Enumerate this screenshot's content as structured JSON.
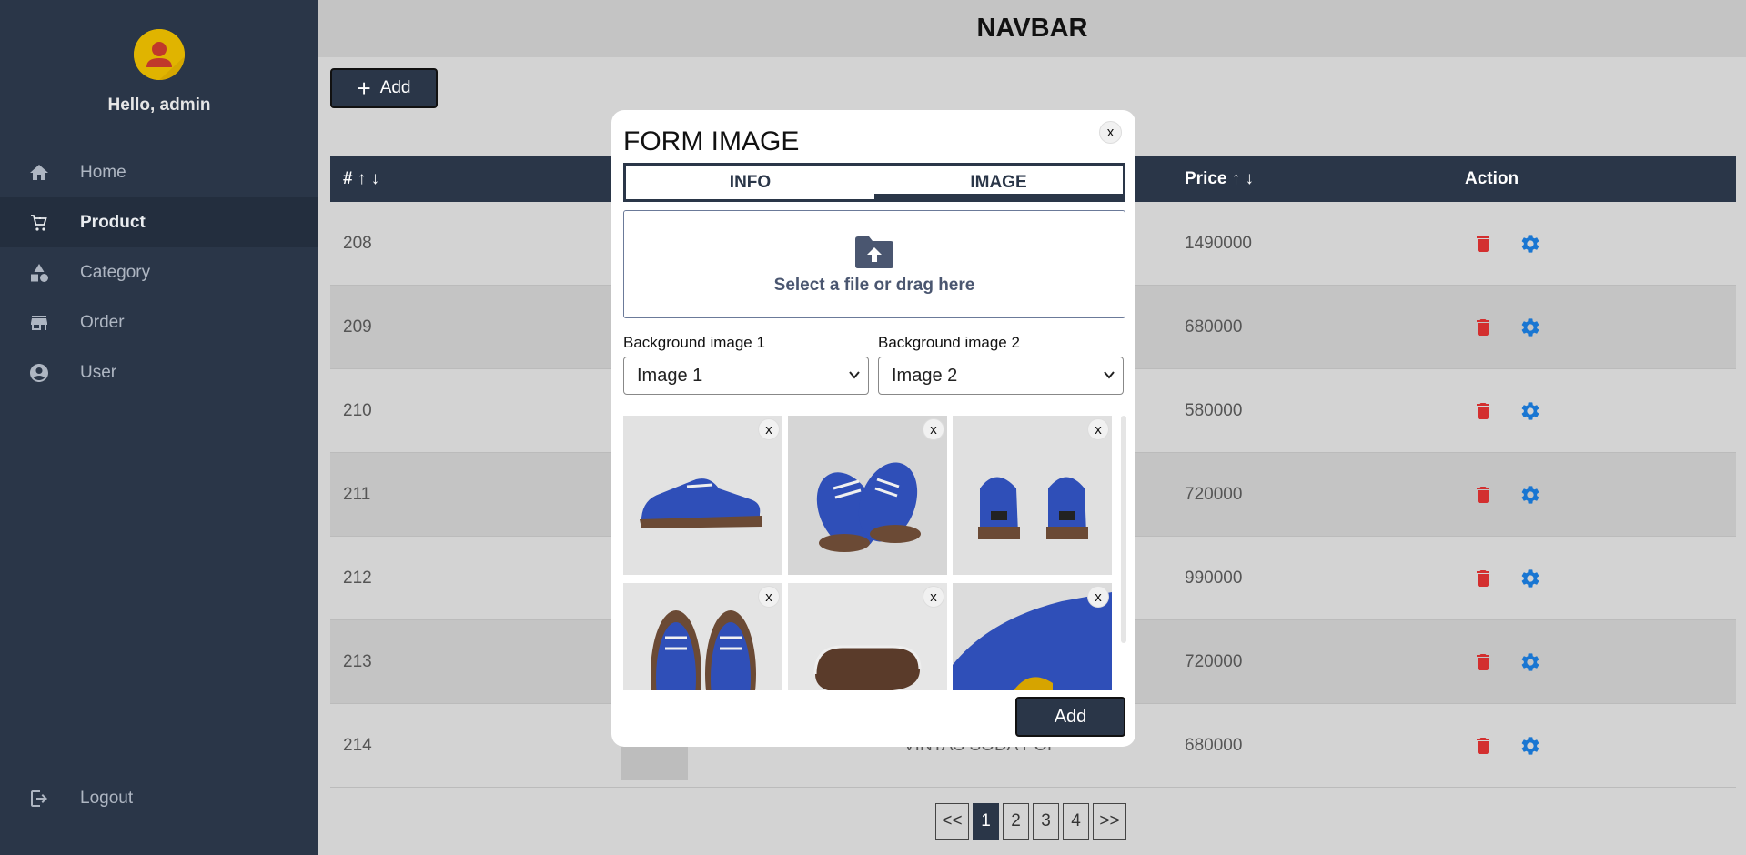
{
  "sidebar": {
    "greeting": "Hello, admin",
    "items": [
      {
        "label": "Home",
        "icon": "home-icon"
      },
      {
        "label": "Product",
        "icon": "cart-icon",
        "active": true
      },
      {
        "label": "Category",
        "icon": "shapes-icon"
      },
      {
        "label": "Order",
        "icon": "store-icon"
      },
      {
        "label": "User",
        "icon": "user-circle-icon"
      }
    ],
    "logout": "Logout"
  },
  "navbar": {
    "title": "NAVBAR"
  },
  "toolbar": {
    "add_label": "Add"
  },
  "table": {
    "headers": {
      "id": "# ↑ ↓",
      "price": "Price ↑ ↓",
      "action": "Action"
    },
    "rows": [
      {
        "id": "208",
        "price": "1490000"
      },
      {
        "id": "209",
        "price": "680000"
      },
      {
        "id": "210",
        "price": "580000"
      },
      {
        "id": "211",
        "price": "720000"
      },
      {
        "id": "212",
        "price": "990000"
      },
      {
        "id": "213",
        "price": "720000"
      },
      {
        "id": "214",
        "name": "VINTAS SODA POP",
        "price": "680000"
      }
    ]
  },
  "pagination": {
    "prev": "<<",
    "pages": [
      "1",
      "2",
      "3",
      "4"
    ],
    "current": "1",
    "next": ">>"
  },
  "modal": {
    "title": "FORM IMAGE",
    "close": "x",
    "tabs": [
      "INFO",
      "IMAGE"
    ],
    "active_tab": "IMAGE",
    "dropzone_text": "Select a file or drag here",
    "bg1_label": "Background image 1",
    "bg1_value": "Image 1",
    "bg2_label": "Background image 2",
    "bg2_value": "Image 2",
    "image_close": "x",
    "add_label": "Add"
  },
  "colors": {
    "sidebar": "#2a3648",
    "delete": "#d32f2f",
    "settings": "#1976d2",
    "avatar": "#e0b400"
  }
}
